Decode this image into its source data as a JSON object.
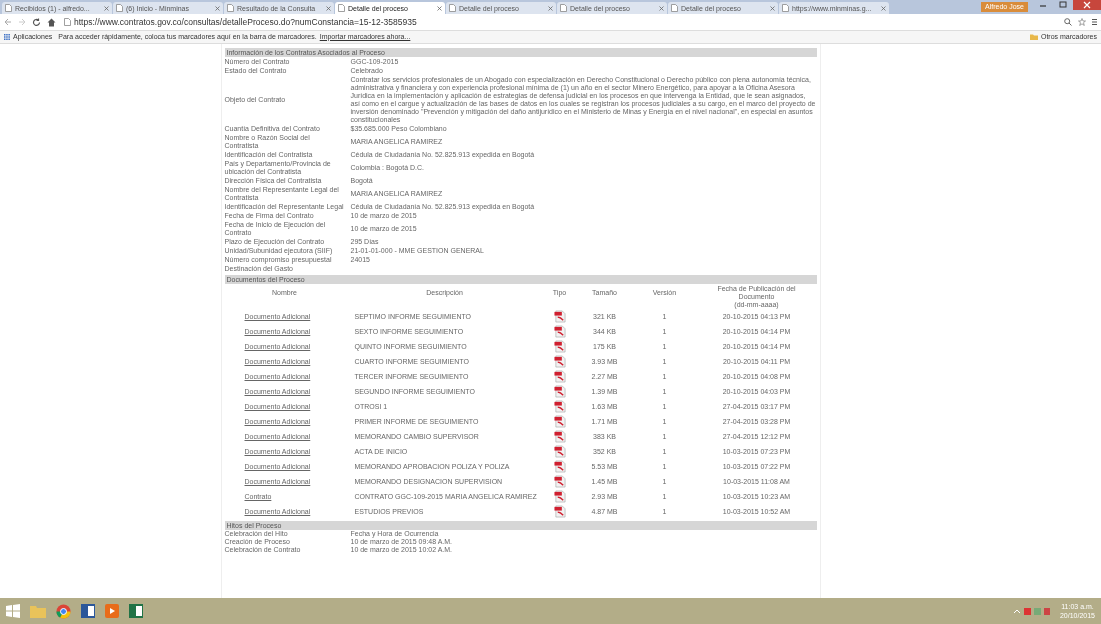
{
  "browser": {
    "tabs": [
      {
        "label": "Recibidos (1) - alfredo...",
        "selected": false
      },
      {
        "label": "(6) Inicio - Minminas",
        "selected": false
      },
      {
        "label": "Resultado de la Consulta",
        "selected": false
      },
      {
        "label": "Detalle del proceso",
        "selected": true
      },
      {
        "label": "Detalle del proceso",
        "selected": false
      },
      {
        "label": "Detalle del proceso",
        "selected": false
      },
      {
        "label": "Detalle del proceso",
        "selected": false
      },
      {
        "label": "https://www.minminas.g...",
        "selected": false
      }
    ],
    "user": "Alfredo Jose",
    "url": "https://www.contratos.gov.co/consultas/detalleProceso.do?numConstancia=15-12-3585935",
    "bookmarks_bar": {
      "apps": "Aplicaciones",
      "hint": "Para acceder rápidamente, coloca tus marcadores aquí en la barra de marcadores.",
      "import_link": "Importar marcadores ahora...",
      "other": "Otros marcadores"
    }
  },
  "contract_info": {
    "title": "Información de los Contratos Asociados al Proceso",
    "rows": [
      {
        "label": "Número del Contrato",
        "value": "GGC-109-2015"
      },
      {
        "label": "Estado del Contrato",
        "value": "Celebrado"
      },
      {
        "label": "Objeto del Contrato",
        "value": "Contratar los servicios profesionales de un Abogado con especialización en Derecho Constitucional o Derecho público con plena autonomía técnica, administrativa y financiera y con experiencia profesional mínima de (1) un año en el sector Minero Energético, para apoyar a la Oficina Asesora Jurídica en la implementación y aplicación de estrategias de defensa judicial en los procesos en que intervenga la Entidad, que le sean asignados, así como en el cargue y actualización de las bases de datos en los cuales se registran los procesos judiciales a su cargo, en el marco del proyecto de inversión denominado \"Prevención y mitigación del daño antijurídico en el Ministerio de Minas y Energía en el nivel nacional\", en especial en asuntos constitucionales"
      },
      {
        "label": "Cuantía Definitiva del Contrato",
        "value": "$35.685.000 Peso Colombiano"
      },
      {
        "label": "Nombre o Razón Social del Contratista",
        "value": "MARIA ANGELICA RAMIREZ"
      },
      {
        "label": "Identificación del Contratista",
        "value": "Cédula de Ciudadanía No. 52.825.913 expedida en Bogotá"
      },
      {
        "label": "País y Departamento/Provincia de ubicación del Contratista",
        "value": "Colombia : Bogotá D.C."
      },
      {
        "label": "Dirección Física del Contratista",
        "value": "Bogotá"
      },
      {
        "label": "Nombre del Representante Legal del Contratista",
        "value": "MARIA ANGELICA RAMIREZ"
      },
      {
        "label": "Identificación del Representante Legal",
        "value": "Cédula de Ciudadanía No. 52.825.913 expedida en Bogotá"
      },
      {
        "label": "Fecha de Firma del Contrato",
        "value": "10 de marzo de 2015"
      },
      {
        "label": "Fecha de Inicio de Ejecución del Contrato",
        "value": "10 de marzo de 2015"
      },
      {
        "label": "Plazo de Ejecución del Contrato",
        "value": "295 Días"
      },
      {
        "label": "Unidad/Subunidad ejecutora (SIIF)",
        "value": "21-01-01-000 - MME GESTION GENERAL"
      },
      {
        "label": "Número compromiso presupuestal",
        "value": "24015"
      },
      {
        "label": "Destinación del Gasto",
        "value": ""
      }
    ]
  },
  "documents": {
    "title": "Documentos del Proceso",
    "columns": [
      "Nombre",
      "Descripción",
      "Tipo",
      "Tamaño",
      "Versión",
      "Fecha de Publicación del Documento"
    ],
    "date_format": "(dd-mm-aaaa)",
    "rows": [
      {
        "name": "Documento Adicional",
        "description": "SEPTIMO INFORME SEGUIMIENTO",
        "size": "321 KB",
        "version": "1",
        "date": "20-10-2015 04:13 PM"
      },
      {
        "name": "Documento Adicional",
        "description": "SEXTO INFORME SEGUIMIENTO",
        "size": "344 KB",
        "version": "1",
        "date": "20-10-2015 04:14 PM"
      },
      {
        "name": "Documento Adicional",
        "description": "QUINTO INFORME SEGUIMIENTO",
        "size": "175 KB",
        "version": "1",
        "date": "20-10-2015 04:14 PM"
      },
      {
        "name": "Documento Adicional",
        "description": "CUARTO INFORME SEGUIMIENTO",
        "size": "3.93 MB",
        "version": "1",
        "date": "20-10-2015 04:11 PM"
      },
      {
        "name": "Documento Adicional",
        "description": "TERCER INFORME SEGUIMIENTO",
        "size": "2.27 MB",
        "version": "1",
        "date": "20-10-2015 04:08 PM"
      },
      {
        "name": "Documento Adicional",
        "description": "SEGUNDO INFORME SEGUIMIENTO",
        "size": "1.39 MB",
        "version": "1",
        "date": "20-10-2015 04:03 PM"
      },
      {
        "name": "Documento Adicional",
        "description": "OTROSI 1",
        "size": "1.63 MB",
        "version": "1",
        "date": "27-04-2015 03:17 PM"
      },
      {
        "name": "Documento Adicional",
        "description": "PRIMER INFORME DE SEGUIMIENTO",
        "size": "1.71 MB",
        "version": "1",
        "date": "27-04-2015 03:28 PM"
      },
      {
        "name": "Documento Adicional",
        "description": "MEMORANDO CAMBIO SUPERVISOR",
        "size": "383 KB",
        "version": "1",
        "date": "27-04-2015 12:12 PM"
      },
      {
        "name": "Documento Adicional",
        "description": "ACTA DE INICIO",
        "size": "352 KB",
        "version": "1",
        "date": "10-03-2015 07:23 PM"
      },
      {
        "name": "Documento Adicional",
        "description": "MEMORANDO APROBACION POLIZA Y POLIZA",
        "size": "5.53 MB",
        "version": "1",
        "date": "10-03-2015 07:22 PM"
      },
      {
        "name": "Documento Adicional",
        "description": "MEMORANDO DESIGNACION SUPERVISION",
        "size": "1.45 MB",
        "version": "1",
        "date": "10-03-2015 11:08 AM"
      },
      {
        "name": "Contrato",
        "description": "CONTRATO GGC-109-2015 MARIA ANGELICA RAMIREZ",
        "size": "2.93 MB",
        "version": "1",
        "date": "10-03-2015 10:23 AM"
      },
      {
        "name": "Documento Adicional",
        "description": "ESTUDIOS PREVIOS",
        "size": "4.87 MB",
        "version": "1",
        "date": "10-03-2015 10:52 AM"
      }
    ]
  },
  "milestones": {
    "title": "Hitos del Proceso",
    "rows": [
      {
        "label": "Celebración del Hito",
        "value": "Fecha y Hora de Ocurrencia"
      },
      {
        "label": "Creación de Proceso",
        "value": "10 de marzo de 2015 09:48 A.M."
      },
      {
        "label": "Celebración de Contrato",
        "value": "10 de marzo de 2015 10:02 A.M."
      }
    ]
  },
  "taskbar": {
    "time": "11:03 a.m.",
    "date": "20/10/2015"
  }
}
